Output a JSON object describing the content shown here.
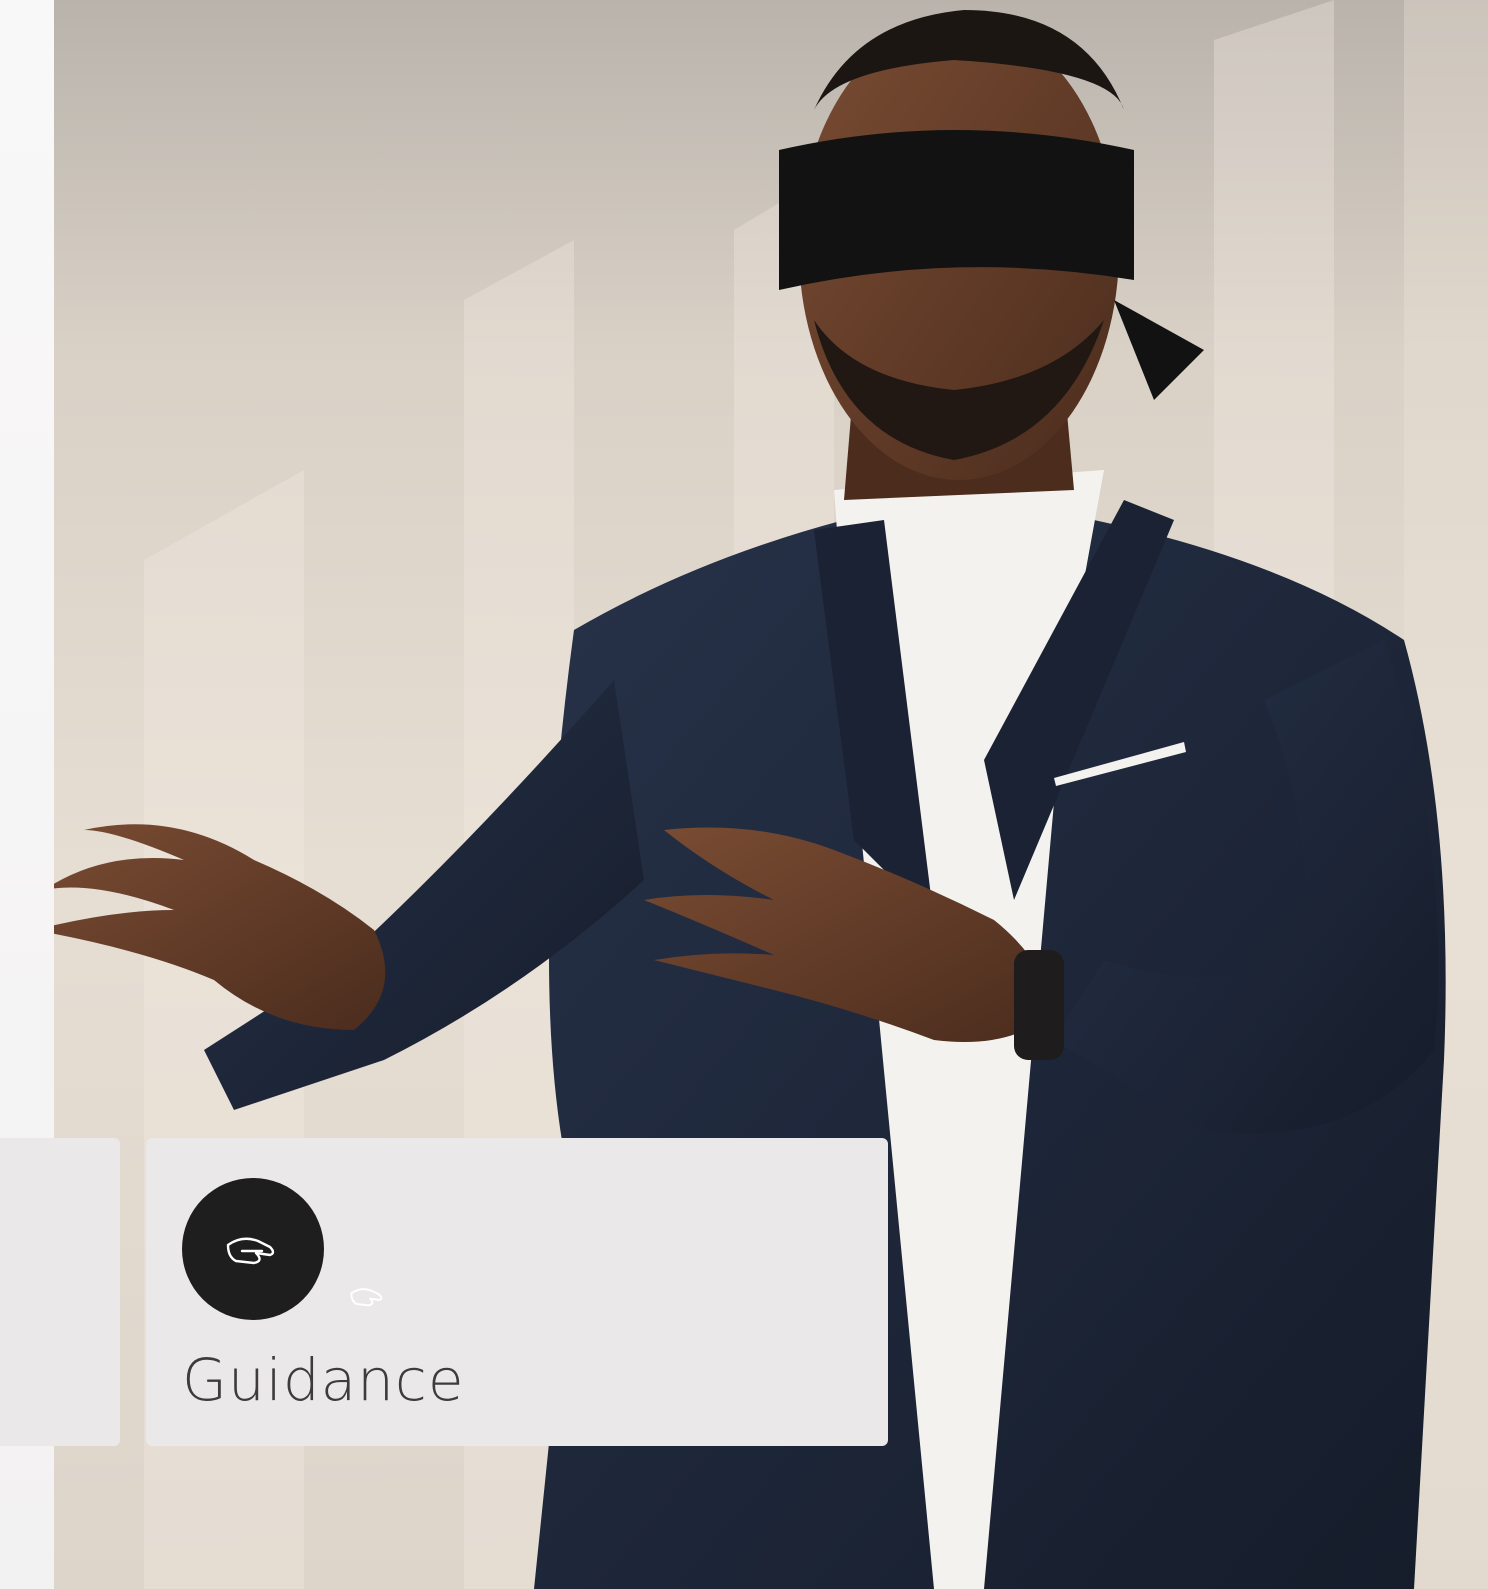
{
  "card": {
    "title": "Guidance",
    "icon": "helping-hand-icon"
  },
  "colors": {
    "card_background": "#ebe8e9",
    "badge_background": "#1f1e1e",
    "text": "#3d3b3b",
    "suit": "#1b2434"
  }
}
